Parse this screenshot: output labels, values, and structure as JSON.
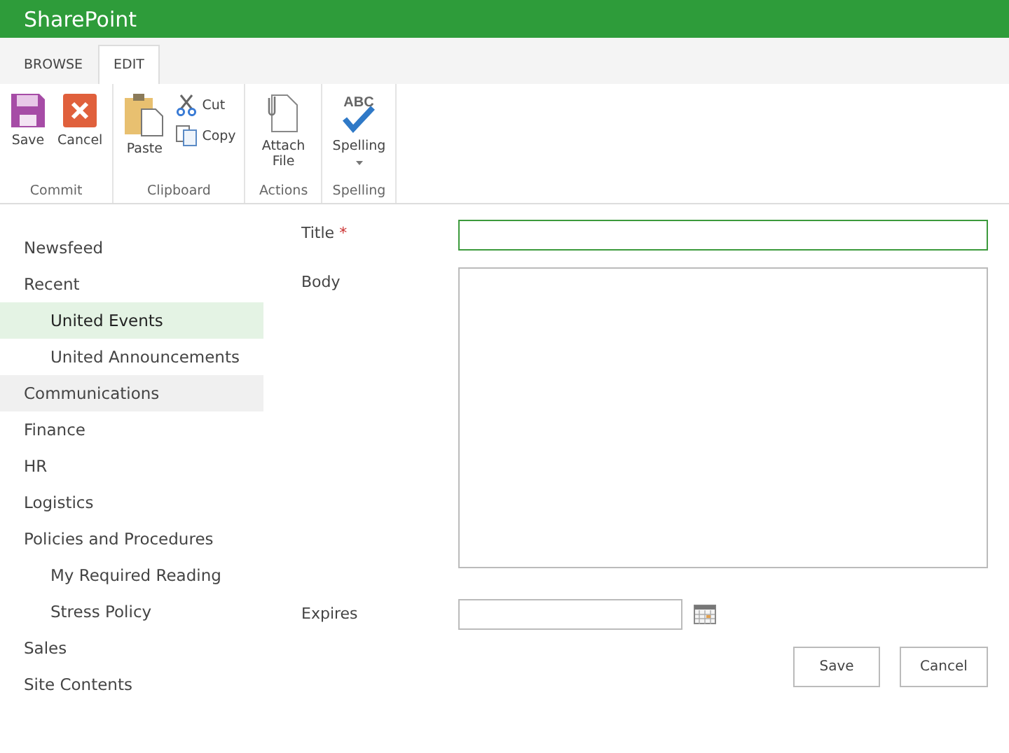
{
  "app": {
    "title": "SharePoint"
  },
  "ribbon_tabs": [
    {
      "label": "BROWSE",
      "selected": false
    },
    {
      "label": "EDIT",
      "selected": true
    }
  ],
  "ribbon_groups": [
    {
      "label": "Commit",
      "buttons": [
        {
          "kind": "save",
          "label": "Save"
        },
        {
          "kind": "cancel",
          "label": "Cancel"
        }
      ]
    },
    {
      "label": "Clipboard",
      "buttons": [
        {
          "kind": "paste",
          "label": "Paste"
        },
        {
          "kind": "cut",
          "label": "Cut"
        },
        {
          "kind": "copy",
          "label": "Copy"
        }
      ]
    },
    {
      "label": "Actions",
      "buttons": [
        {
          "kind": "attach",
          "label": "Attach File"
        }
      ]
    },
    {
      "label": "Spelling",
      "buttons": [
        {
          "kind": "spelling",
          "label": "Spelling",
          "icon_text": "ABC",
          "dropdown": true
        }
      ]
    }
  ],
  "nav": [
    {
      "label": "Newsfeed",
      "selected": false,
      "highlighted": false
    },
    {
      "label": "Recent",
      "selected": false,
      "highlighted": false,
      "children": [
        {
          "label": "United Events",
          "selected": true,
          "highlighted": false
        },
        {
          "label": "United Announcements",
          "selected": false,
          "highlighted": false
        }
      ]
    },
    {
      "label": "Communications",
      "selected": false,
      "highlighted": true
    },
    {
      "label": "Finance",
      "selected": false,
      "highlighted": false
    },
    {
      "label": "HR",
      "selected": false,
      "highlighted": false
    },
    {
      "label": "Logistics",
      "selected": false,
      "highlighted": false
    },
    {
      "label": "Policies and Procedures",
      "selected": false,
      "highlighted": false,
      "children": [
        {
          "label": "My Required Reading",
          "selected": false,
          "highlighted": false
        },
        {
          "label": "Stress Policy",
          "selected": false,
          "highlighted": false
        }
      ]
    },
    {
      "label": "Sales",
      "selected": false,
      "highlighted": false
    },
    {
      "label": "Site Contents",
      "selected": false,
      "highlighted": false
    }
  ],
  "form": {
    "fields": [
      {
        "kind": "text",
        "label": "Title",
        "required_mark": "*",
        "focused": true
      },
      {
        "kind": "textarea",
        "label": "Body",
        "focused": false
      },
      {
        "kind": "date",
        "label": "Expires",
        "focused": false
      }
    ],
    "buttons": [
      "Save",
      "Cancel"
    ]
  }
}
